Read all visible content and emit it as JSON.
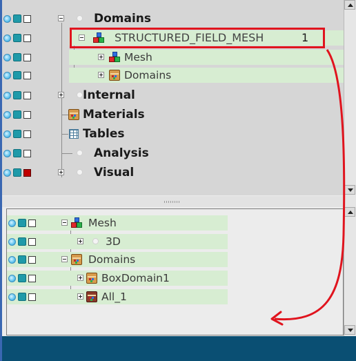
{
  "top_tree": {
    "domains": "Domains",
    "structured_field_mesh": "STRUCTURED_FIELD_MESH",
    "structured_field_mesh_suffix": "1",
    "mesh": "Mesh",
    "sub_domains": "Domains",
    "internal": "Internal",
    "materials": "Materials",
    "tables": "Tables",
    "analysis": "Analysis",
    "visual": "Visual"
  },
  "bottom_tree": {
    "mesh": "Mesh",
    "three_d": "3D",
    "domains": "Domains",
    "box_domain": "BoxDomain1",
    "all": "All_1"
  },
  "colors": {
    "highlight": "#d7edd2",
    "annotation": "#e0141e",
    "bottom_bar": "#0a4f73"
  }
}
